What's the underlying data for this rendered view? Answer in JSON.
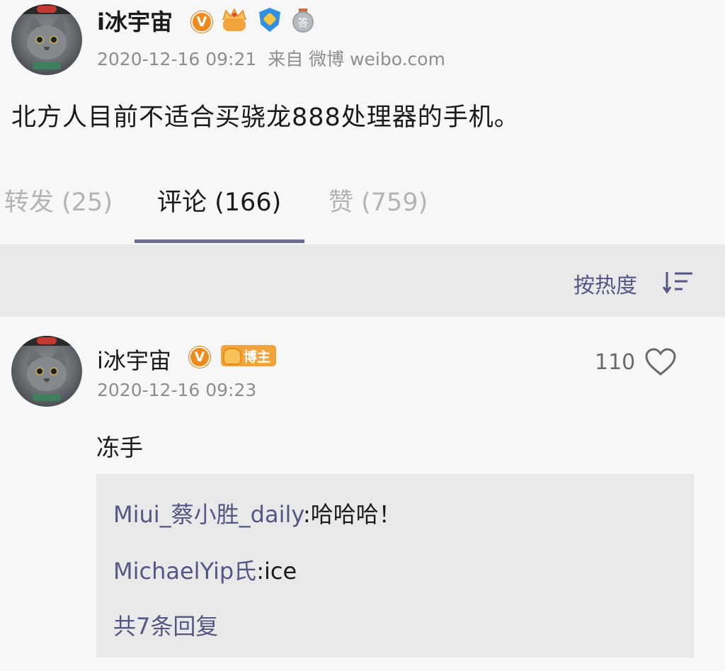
{
  "post": {
    "author": "i冰宇宙",
    "verified_mark": "V",
    "timestamp": "2020-12-16 09:21",
    "source": "来自 微博 weibo.com",
    "content": "北方人目前不适合买骁龙888处理器的手机。",
    "badges": [
      "vip-crown-icon",
      "shield-badge-icon",
      "medal-badge-icon"
    ],
    "medal_char": "答"
  },
  "tabs": [
    {
      "label": "转发 (25)",
      "active": false
    },
    {
      "label": "评论 (166)",
      "active": true
    },
    {
      "label": "赞 (759)",
      "active": false
    }
  ],
  "sort": {
    "label": "按热度",
    "icon": "sort-desc-icon"
  },
  "comment": {
    "author": "i冰宇宙",
    "verified_mark": "V",
    "tag": "博主",
    "timestamp": "2020-12-16 09:23",
    "text": "冻手",
    "likes": "110",
    "replies": [
      {
        "user": "Miui_蔡小胜_daily",
        "text": ":哈哈哈！"
      },
      {
        "user": "MichaelYip氏",
        "text": ":ice"
      }
    ],
    "more_replies": "共7条回复"
  },
  "colors": {
    "link": "#545783",
    "tab_indicator": "#6c6d91",
    "verified": "#f08a1c",
    "tag": "#f2a43c"
  }
}
